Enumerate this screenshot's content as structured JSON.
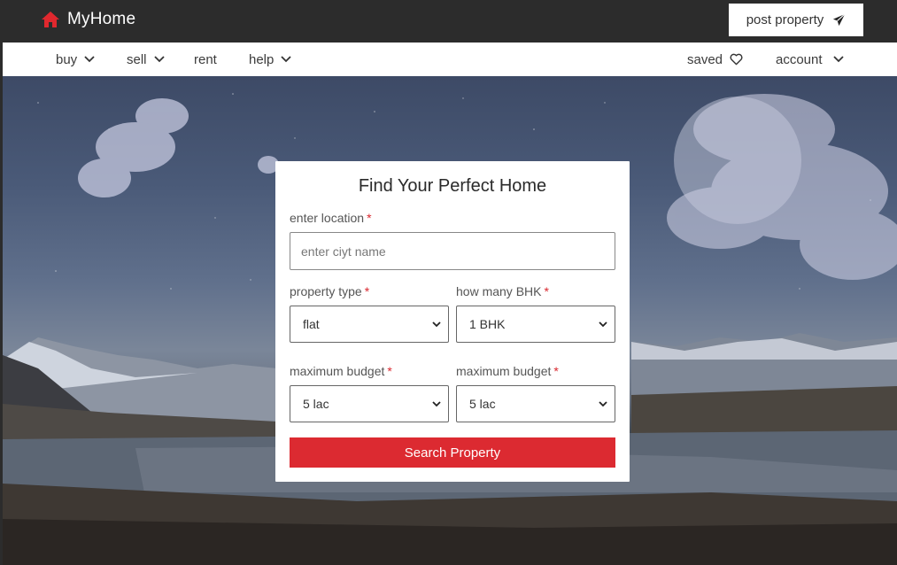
{
  "brand": {
    "name": "MyHome",
    "icon": "house-icon",
    "accent": "#e0282e"
  },
  "header": {
    "post_label": "post property",
    "post_icon": "paper-plane-icon"
  },
  "nav": {
    "buy": "buy",
    "sell": "sell",
    "rent": "rent",
    "help": "help",
    "saved": "saved",
    "account": "account"
  },
  "search": {
    "title": "Find Your Perfect Home",
    "location_label": "enter location",
    "location_placeholder": "enter ciyt name",
    "location_value": "",
    "property_type_label": "property type",
    "property_type_value": "flat",
    "bhk_label": "how many BHK",
    "bhk_value": "1 BHK",
    "budget_label_1": "maximum budget",
    "budget_value_1": "5 lac",
    "budget_label_2": "maximum budget",
    "budget_value_2": "5 lac",
    "required_mark": "*",
    "button_label": "Search Property",
    "button_color": "#dc2a31"
  }
}
